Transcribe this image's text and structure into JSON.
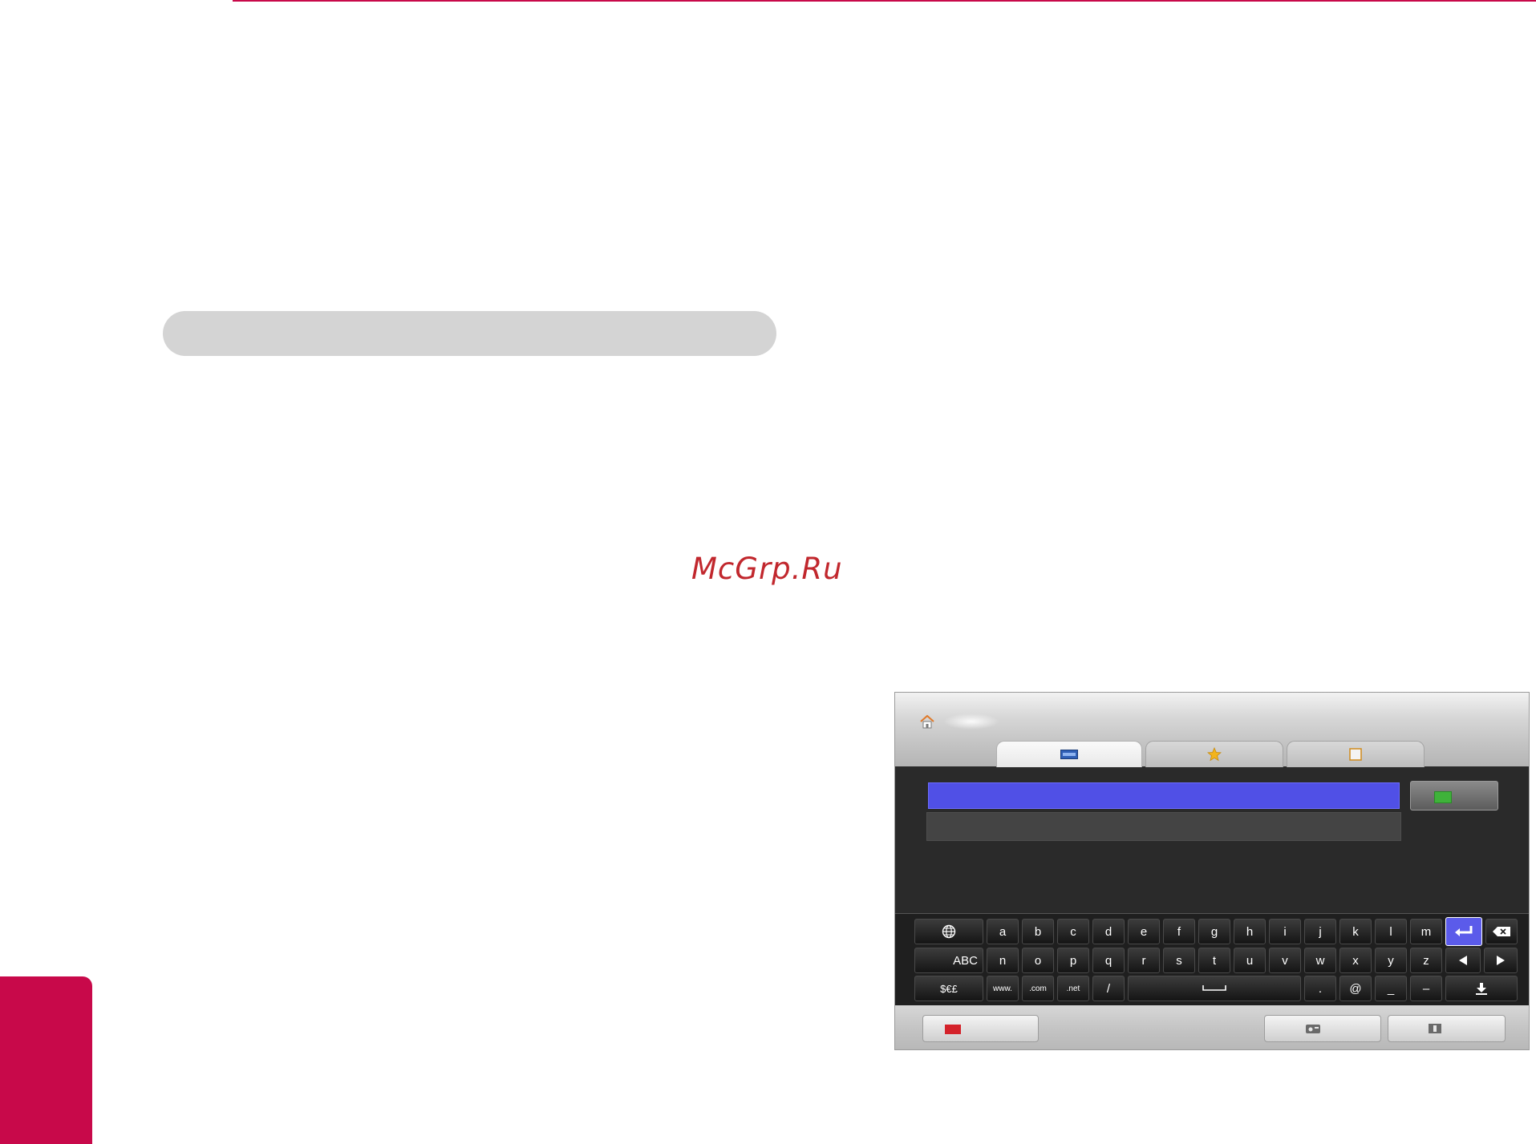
{
  "watermark": "McGrp.Ru",
  "colors": {
    "accent": "#c8094a",
    "watermark": "#c1272d",
    "url_field": "#5050e6",
    "go_button": "#3fb23a",
    "exit_button": "#d4222a"
  },
  "browser": {
    "tabs": [
      {
        "id": "url",
        "icon": "www-icon"
      },
      {
        "id": "favorites",
        "icon": "star-icon"
      },
      {
        "id": "history",
        "icon": "history-icon"
      }
    ],
    "url_value": "",
    "suggestion_value": ""
  },
  "keyboard": {
    "row1": [
      "a",
      "b",
      "c",
      "d",
      "e",
      "f",
      "g",
      "h",
      "i",
      "j",
      "k",
      "l",
      "m"
    ],
    "row2": [
      "n",
      "o",
      "p",
      "q",
      "r",
      "s",
      "t",
      "u",
      "v",
      "w",
      "x",
      "y",
      "z"
    ],
    "mode_label": "ABC",
    "symbols_label": "$€£",
    "www_label": "www.",
    "com_label": ".com",
    "net_label": ".net",
    "slash": "/",
    "dot": ".",
    "at": "@",
    "underscore": "_",
    "dash": "–"
  }
}
